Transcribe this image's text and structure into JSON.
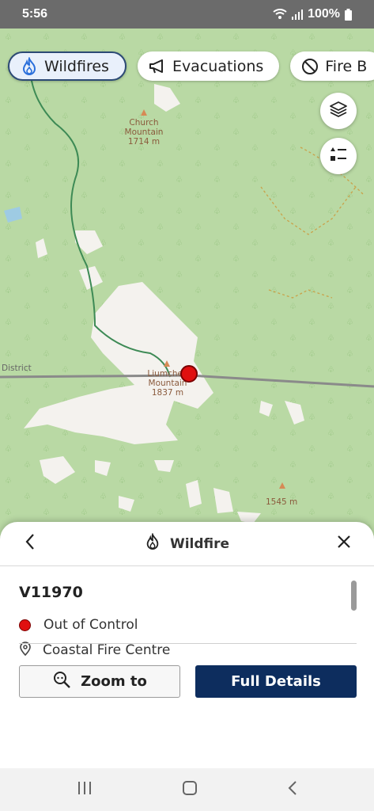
{
  "status_bar": {
    "time": "5:56",
    "battery": "100%"
  },
  "filters": [
    {
      "label": "Wildfires",
      "icon": "flame-icon",
      "active": true
    },
    {
      "label": "Evacuations",
      "icon": "megaphone-icon",
      "active": false
    },
    {
      "label": "Fire B",
      "icon": "ban-icon",
      "active": false
    }
  ],
  "map": {
    "labels": {
      "church_name": "Church",
      "church_name2": "Mountain",
      "church_elev": "1714 m",
      "liumchen_name": "Liumchen",
      "liumchen_name2": "Mountain",
      "liumchen_elev": "1837 m",
      "district": "District",
      "peak_elev": "1545 m"
    },
    "buttons": {
      "layers": "layers-icon",
      "legend": "legend-icon"
    }
  },
  "sheet": {
    "title": "Wildfire",
    "fire_id": "V11970",
    "status": "Out of Control",
    "status_color": "#e01010",
    "fire_centre": "Coastal Fire Centre",
    "zoom_label": "Zoom to",
    "details_label": "Full Details"
  },
  "colors": {
    "primary": "#0d2d5e",
    "map_green": "#b9d9a4",
    "fire_red": "#e01010"
  }
}
